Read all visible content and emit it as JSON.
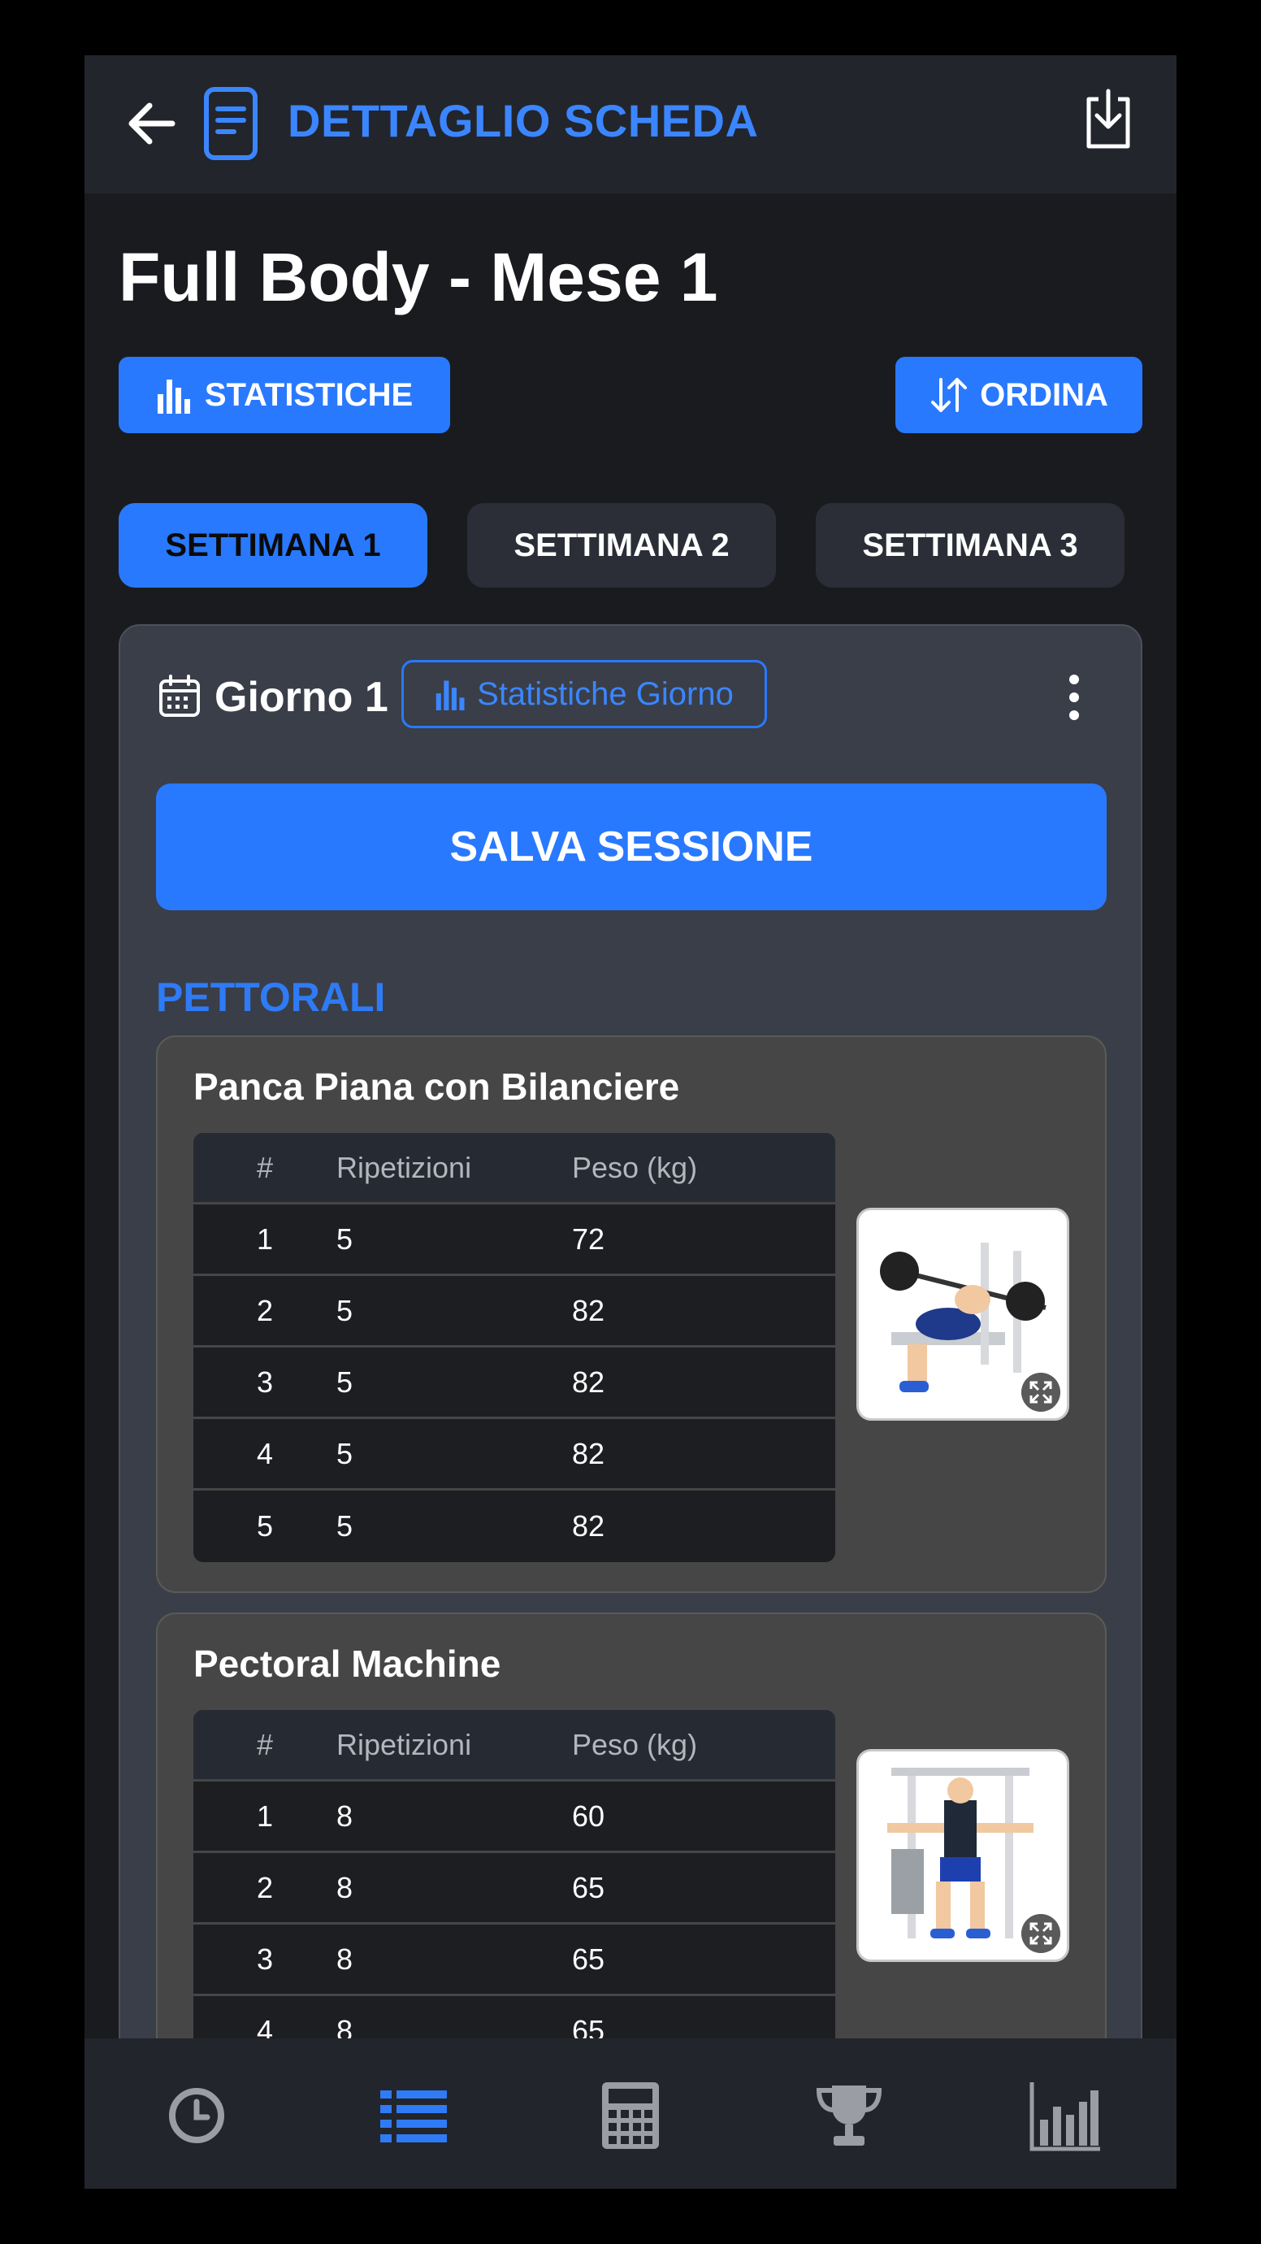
{
  "header": {
    "title": "DETTAGLIO SCHEDA"
  },
  "page": {
    "title": "Full Body - Mese 1"
  },
  "actions": {
    "stats_label": "STATISTICHE",
    "sort_label": "ORDINA"
  },
  "tabs": [
    {
      "label": "SETTIMANA 1",
      "active": true
    },
    {
      "label": "SETTIMANA 2",
      "active": false
    },
    {
      "label": "SETTIMANA 3",
      "active": false
    }
  ],
  "day": {
    "title": "Giorno 1",
    "stats_label": "Statistiche Giorno",
    "save_label": "SALVA SESSIONE"
  },
  "section": {
    "title": "PETTORALI"
  },
  "table_headers": [
    "#",
    "Ripetizioni",
    "Peso (kg)"
  ],
  "exercises": [
    {
      "name": "Panca Piana con Bilanciere",
      "sets": [
        [
          "1",
          "5",
          "72"
        ],
        [
          "2",
          "5",
          "82"
        ],
        [
          "3",
          "5",
          "82"
        ],
        [
          "4",
          "5",
          "82"
        ],
        [
          "5",
          "5",
          "82"
        ]
      ]
    },
    {
      "name": "Pectoral Machine",
      "sets": [
        [
          "1",
          "8",
          "60"
        ],
        [
          "2",
          "8",
          "65"
        ],
        [
          "3",
          "8",
          "65"
        ],
        [
          "4",
          "8",
          "65"
        ]
      ]
    }
  ],
  "nav": [
    "history-icon",
    "list-icon",
    "calculator-icon",
    "trophy-icon",
    "bar-chart-icon"
  ],
  "colors": {
    "accent": "#2979ff",
    "background": "#1a1b1f",
    "card": "#3a3e48",
    "exercise_card": "#464646"
  }
}
